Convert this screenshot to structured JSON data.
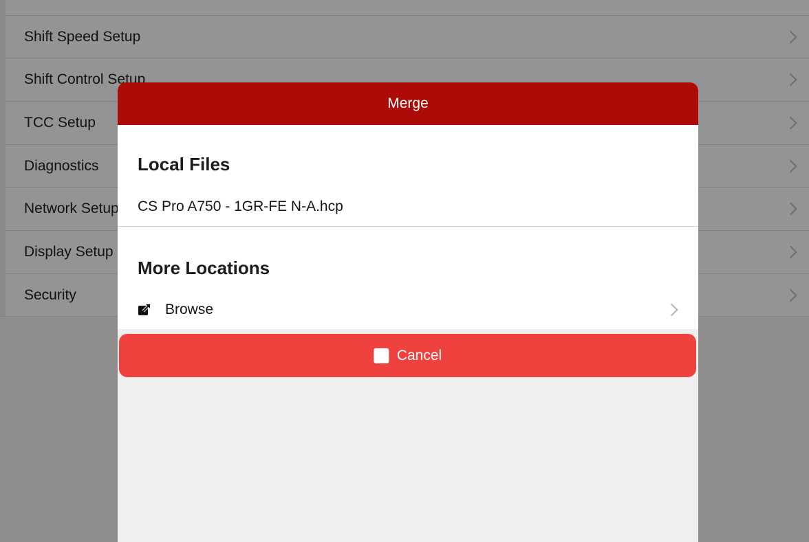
{
  "settings": {
    "items": [
      {
        "label": "Shift Speed Setup"
      },
      {
        "label": "Shift Control Setup"
      },
      {
        "label": "TCC Setup"
      },
      {
        "label": "Diagnostics"
      },
      {
        "label": "Network Setup"
      },
      {
        "label": "Display Setup"
      },
      {
        "label": "Security"
      }
    ]
  },
  "modal": {
    "title": "Merge",
    "local_files": {
      "title": "Local Files",
      "items": [
        {
          "name": "CS Pro A750 - 1GR-FE N-A.hcp"
        }
      ]
    },
    "more_locations": {
      "title": "More Locations",
      "browse_label": "Browse",
      "browse_icon": "external-link-icon"
    },
    "cancel": {
      "label": "Cancel",
      "icon": "stop-icon"
    }
  },
  "colors": {
    "header": "#ad0b08",
    "cancel": "#ef423f",
    "overlay": "#949494"
  }
}
